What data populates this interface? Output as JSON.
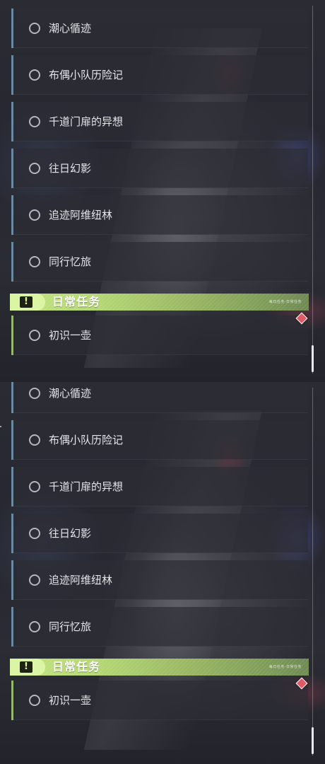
{
  "panels": [
    {
      "quests": [
        {
          "label": "潮心循迹"
        },
        {
          "label": "布偶小队历险记"
        },
        {
          "label": "千道门扉的异想"
        },
        {
          "label": "往日幻影"
        },
        {
          "label": "追迹阿维纽林"
        },
        {
          "label": "同行忆旅"
        }
      ],
      "daily_section": {
        "title": "日常任务",
        "badge_icon": "exclamation-icon",
        "fine_print": "每日任务·日常任务",
        "quests": [
          {
            "label": "初识一壶"
          }
        ]
      },
      "marker_icon": "red-diamond-icon",
      "marker_color": "#e05a66"
    },
    {
      "quests": [
        {
          "label": "潮心循迹"
        },
        {
          "label": "布偶小队历险记"
        },
        {
          "label": "千道门扉的异想"
        },
        {
          "label": "往日幻影"
        },
        {
          "label": "追迹阿维纽林"
        },
        {
          "label": "同行忆旅"
        }
      ],
      "daily_section": {
        "title": "日常任务",
        "badge_icon": "exclamation-icon",
        "fine_print": "每日任务·日常任务",
        "quests": [
          {
            "label": "初识一壶"
          }
        ]
      },
      "marker_icon": "red-diamond-icon",
      "marker_color": "#e05a66"
    }
  ],
  "colors": {
    "story_accent": "#6b8aa1",
    "daily_accent": "#94b86c",
    "daily_header": "#b4d774"
  }
}
